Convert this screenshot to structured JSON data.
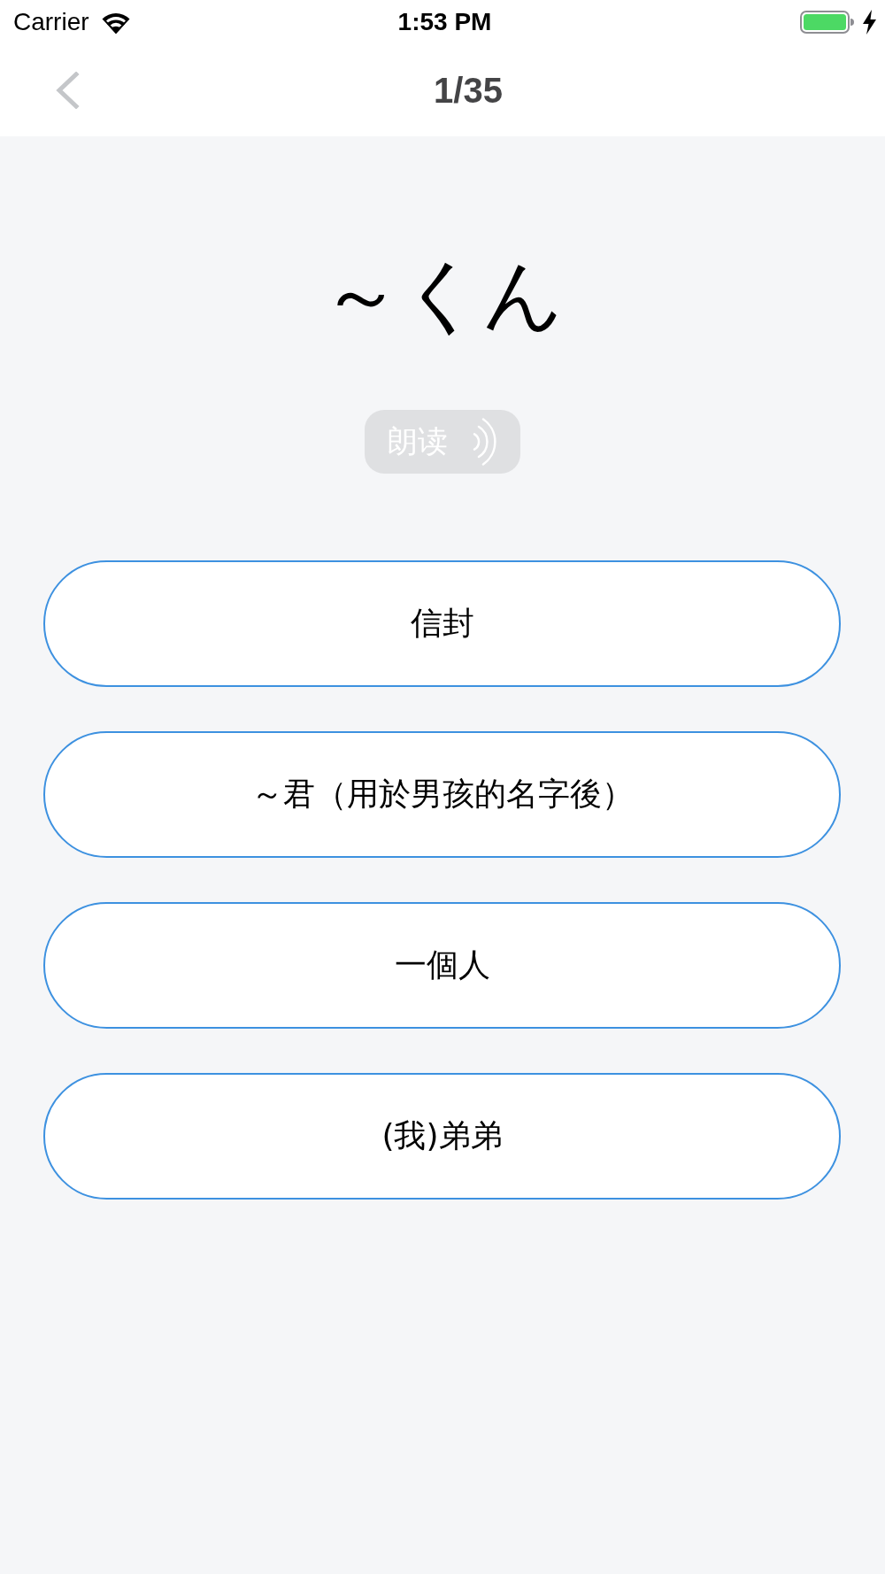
{
  "status_bar": {
    "carrier": "Carrier",
    "time": "1:53 PM"
  },
  "nav_bar": {
    "title": "1/35"
  },
  "word": "～くん",
  "read_button": {
    "label": "朗读"
  },
  "options": [
    {
      "label": "信封",
      "selected": false
    },
    {
      "label": "～君（用於男孩的名字後）",
      "selected": false
    },
    {
      "label": "一個人",
      "selected": false
    },
    {
      "label": "(我)弟弟",
      "selected": false
    }
  ]
}
